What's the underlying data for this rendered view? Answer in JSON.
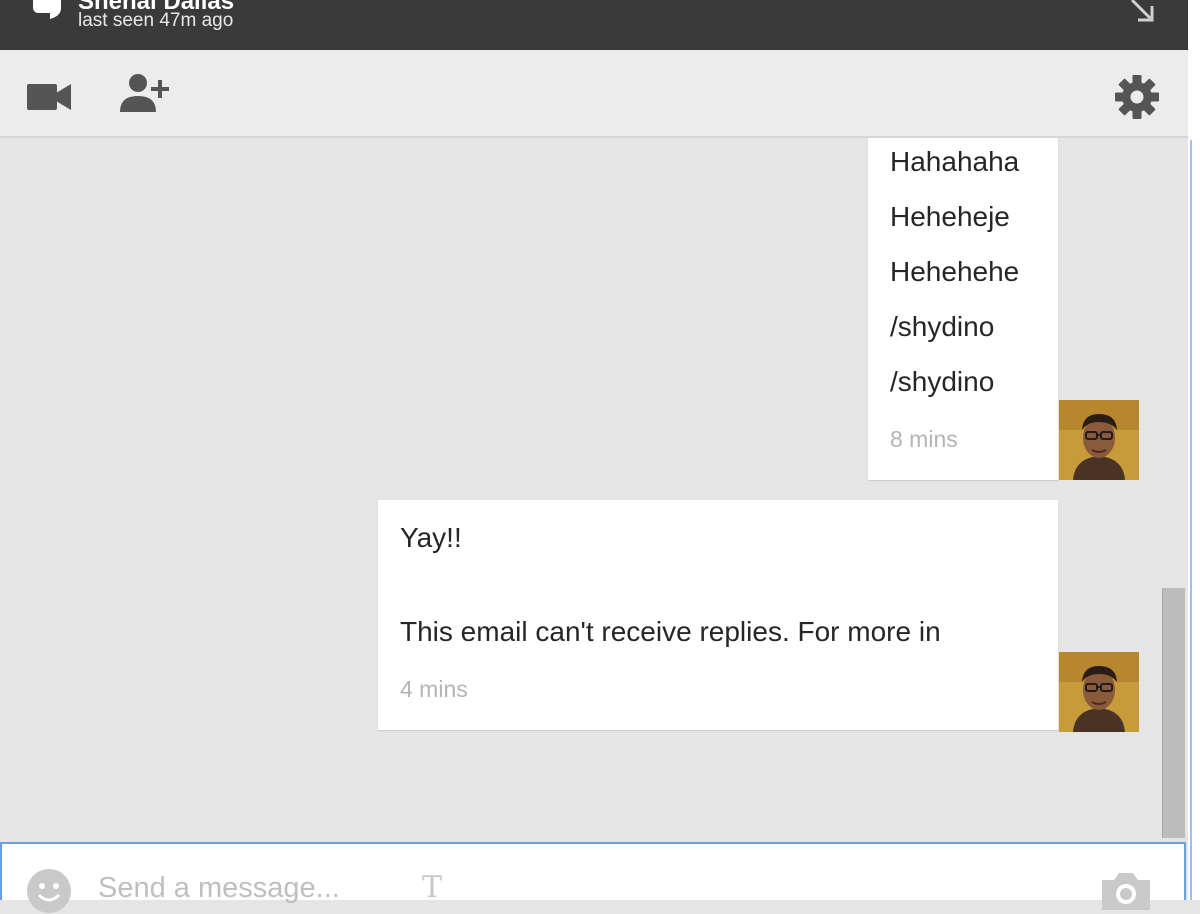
{
  "header": {
    "contact_name": "Snehal Dalias",
    "last_seen": "last seen 47m ago"
  },
  "toolbar": {
    "tools": [
      "video-call-icon",
      "add-person-icon",
      "settings-gear-icon"
    ]
  },
  "messages": [
    {
      "lines": [
        "Hahahaha",
        "Heheheje",
        "Hehehehe",
        "/shydino",
        "/shydino"
      ],
      "time": "8 mins"
    },
    {
      "lines": [
        "Yay!!",
        "",
        "This email can't receive replies. For more in"
      ],
      "time": "4 mins"
    }
  ],
  "composer": {
    "placeholder": "Send a message...",
    "cursor_glyph": "T"
  },
  "colors": {
    "header_bg": "#3a3a3a",
    "toolbar_bg": "#ececec",
    "conversation_bg": "#e5e5e5",
    "bubble_bg": "#ffffff",
    "composer_border": "#6d9eeb",
    "timestamp": "#b4b4b4"
  }
}
